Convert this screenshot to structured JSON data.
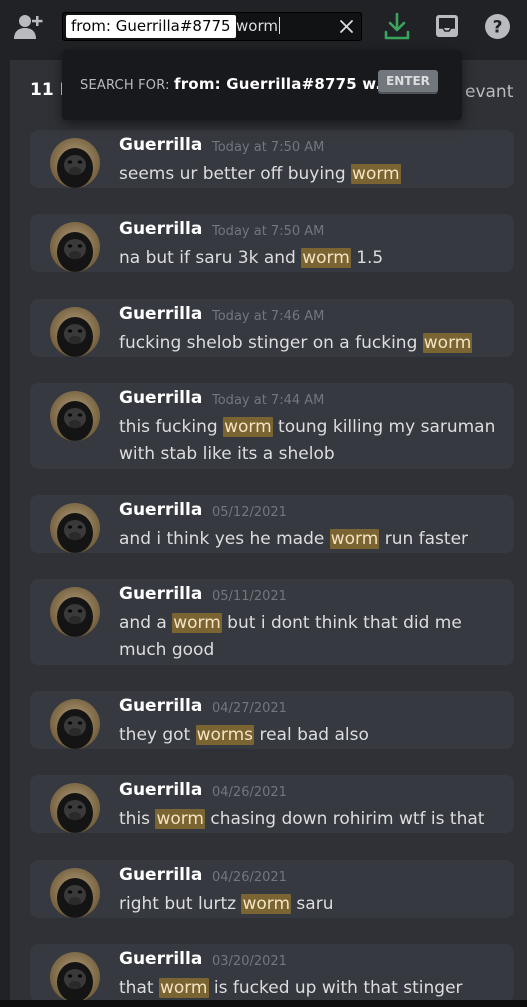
{
  "search": {
    "filter": "from: Guerrilla#8775",
    "query": "worm"
  },
  "popout": {
    "label": "SEARCH FOR: ",
    "value": "from: Guerrilla#8775 w...",
    "enter": "ENTER"
  },
  "results_header": {
    "count": "11 R",
    "sort": "evant"
  },
  "colors": {
    "highlight": "#7a6432",
    "download_green": "#3ba55c",
    "card_bg": "#36393f"
  },
  "messages": [
    {
      "author": "Guerrilla",
      "time": "Today at 7:50 AM",
      "pre": "seems ur better off buying ",
      "hit": "worm",
      "post": ""
    },
    {
      "author": "Guerrilla",
      "time": "Today at 7:50 AM",
      "pre": "na but if saru 3k and ",
      "hit": "worm",
      "post": " 1.5"
    },
    {
      "author": "Guerrilla",
      "time": "Today at 7:46 AM",
      "pre": "fucking shelob stinger on a fucking ",
      "hit": "worm",
      "post": ""
    },
    {
      "author": "Guerrilla",
      "time": "Today at 7:44 AM",
      "pre": "this fucking ",
      "hit": "worm",
      "post": " toung killing my saruman with stab like its a shelob"
    },
    {
      "author": "Guerrilla",
      "time": "05/12/2021",
      "pre": "and i think yes he made ",
      "hit": "worm",
      "post": " run faster"
    },
    {
      "author": "Guerrilla",
      "time": "05/11/2021",
      "pre": "and a ",
      "hit": "worm",
      "post": " but i dont think that did me much good"
    },
    {
      "author": "Guerrilla",
      "time": "04/27/2021",
      "pre": "they got ",
      "hit": "worms",
      "post": " real bad also"
    },
    {
      "author": "Guerrilla",
      "time": "04/26/2021",
      "pre": "this ",
      "hit": "worm",
      "post": " chasing down rohirim wtf is that"
    },
    {
      "author": "Guerrilla",
      "time": "04/26/2021",
      "pre": "right but lurtz ",
      "hit": "worm",
      "post": " saru"
    },
    {
      "author": "Guerrilla",
      "time": "03/20/2021",
      "pre": "that ",
      "hit": "worm",
      "post": " is fucked up with that stinger"
    }
  ]
}
